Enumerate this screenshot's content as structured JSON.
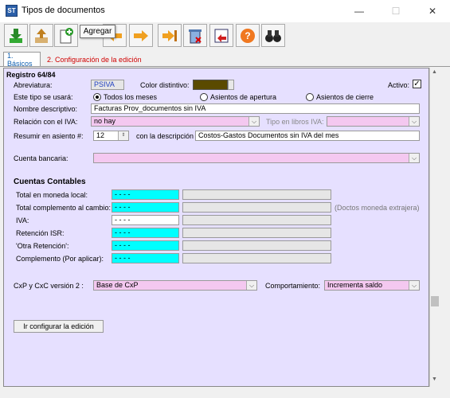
{
  "window": {
    "title": "Tipos de documentos",
    "min": "—",
    "max": "☐",
    "close": "✕",
    "icon_text": "ST"
  },
  "tooltip": "Agregar",
  "tabs": [
    {
      "label": "1. Básicos"
    },
    {
      "label": "2. Configuración de la edición"
    }
  ],
  "form": {
    "registro": "Registro 64/84",
    "abreviatura_label": "Abreviatura:",
    "abreviatura_value": "PSIVA",
    "color_label": "Color distintivo:",
    "color_value": "#5a4a00",
    "activo_label": "Activo:",
    "activo_checked": "✓",
    "uso_label": "Este tipo se usará:",
    "radio_options": [
      "Todos los meses",
      "Asientos de apertura",
      "Asientos de cierre"
    ],
    "nombre_label": "Nombre descriptivo:",
    "nombre_value": "Facturas Prov_documentos sin IVA",
    "relacion_label": "Relación con el IVA:",
    "relacion_value": "no hay",
    "tipo_libros_label": "Tipo en libros IVA:",
    "tipo_libros_value": "",
    "resumir_label": "Resumir en asiento #:",
    "resumir_value": "12",
    "descripcion_label": "con la descripción",
    "descripcion_value": "Costos-Gastos Documentos sin IVA del mes",
    "cuenta_bancaria_label": "Cuenta bancaria:",
    "cuenta_bancaria_value": ""
  },
  "cuentas": {
    "title": "Cuentas Contables",
    "rows": [
      {
        "label": "Total en moneda local:",
        "value": "- - - -",
        "highlight": true
      },
      {
        "label": "Total complemento al cambio:",
        "value": "- - - -",
        "highlight": true
      },
      {
        "label": "IVA:",
        "value": "- - - -",
        "highlight": false
      },
      {
        "label": "Retención ISR:",
        "value": "- - - -",
        "highlight": true
      },
      {
        "label": "'Otra Retención':",
        "value": "- - - -",
        "highlight": true
      },
      {
        "label": "Complemento (Por aplicar):",
        "value": "- - - -",
        "highlight": true
      }
    ],
    "note": "(Doctos moneda extrajera)"
  },
  "cxp": {
    "label": "CxP y CxC versión 2 :",
    "value": "Base de CxP",
    "comportamiento_label": "Comportamiento:",
    "comportamiento_value": "Incrementa saldo"
  },
  "config_button": "Ir configurar la edición"
}
